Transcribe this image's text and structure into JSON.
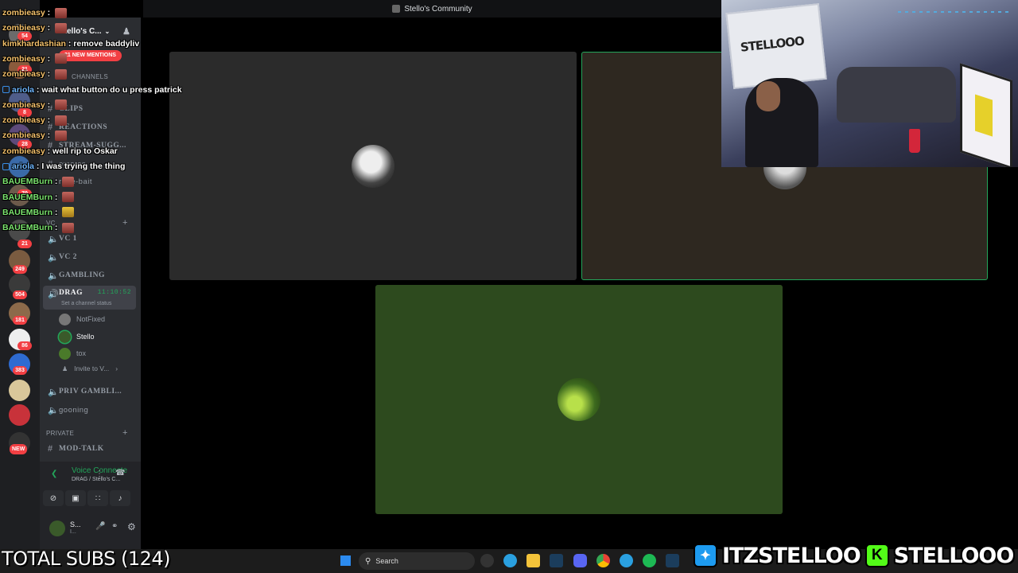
{
  "titlebar": {
    "title": "Stello's Community"
  },
  "server": {
    "name": "Stello's C...",
    "mentions_pill": "21 NEW MENTIONS"
  },
  "server_rail": {
    "badges": [
      "54",
      "21",
      "8",
      "28",
      "70",
      "21",
      "249",
      "504",
      "181",
      "86",
      "383"
    ],
    "new_badge": "NEW"
  },
  "channels": {
    "category_channels": "channels",
    "list": [
      {
        "name": "CLIPS"
      },
      {
        "name": "REACTIONS"
      },
      {
        "name": "STREAM-SUGG..."
      },
      {
        "name": "emotes"
      },
      {
        "name": "rage-bait"
      }
    ],
    "voice_category": "VC",
    "voice": [
      {
        "name": "VC 1"
      },
      {
        "name": "VC 2"
      },
      {
        "name": "GAMBLING"
      }
    ],
    "active_voice": {
      "name": "DRAG",
      "time": "11:10:52",
      "status": "Set a channel status"
    },
    "members": [
      {
        "name": "NotFixed"
      },
      {
        "name": "Stello"
      },
      {
        "name": "tox"
      }
    ],
    "invite": "Invite to V...",
    "after": [
      {
        "name": "PRIV GAMBLI..."
      },
      {
        "name": "gooning"
      }
    ],
    "private_category": "PRIVATE",
    "private": [
      {
        "name": "MOD-TALK"
      }
    ]
  },
  "voice_panel": {
    "status": "Voice Connecte",
    "sub": "DRAG / Stello's C...",
    "user": "S...",
    "user_sub": "I..."
  },
  "chat": [
    {
      "user": "zombieasy",
      "text": "",
      "color": "#f4c16b",
      "emote": "red"
    },
    {
      "user": "zombieasy",
      "text": "",
      "color": "#f4c16b",
      "emote": "red"
    },
    {
      "user": "kimkhardashian",
      "text": "remove baddyliv",
      "color": "#f4c16b",
      "emote": ""
    },
    {
      "user": "zombieasy",
      "text": "",
      "color": "#f4c16b",
      "emote": "red"
    },
    {
      "user": "zombieasy",
      "text": "",
      "color": "#f4c16b",
      "emote": "red"
    },
    {
      "user": "ariola",
      "text": "wait what button do u press patrick",
      "color": "#6fb7ff",
      "emote": ""
    },
    {
      "user": "zombieasy",
      "text": "",
      "color": "#f4c16b",
      "emote": "red"
    },
    {
      "user": "zombieasy",
      "text": "",
      "color": "#f4c16b",
      "emote": "red"
    },
    {
      "user": "zombieasy",
      "text": "",
      "color": "#f4c16b",
      "emote": "red"
    },
    {
      "user": "zombieasy",
      "text": "well rip to Oskar",
      "color": "#f4c16b",
      "emote": ""
    },
    {
      "user": "ariola",
      "text": "I was trying the thing",
      "color": "#6fb7ff",
      "emote": ""
    },
    {
      "user": "BAUEMBurn",
      "text": "",
      "color": "#7be36e",
      "emote": "red"
    },
    {
      "user": "BAUEMBurn",
      "text": "",
      "color": "#7be36e",
      "emote": "red"
    },
    {
      "user": "BAUEMBurn",
      "text": "",
      "color": "#7be36e",
      "emote": "gold"
    },
    {
      "user": "BAUEMBurn",
      "text": "",
      "color": "#7be36e",
      "emote": "red"
    }
  ],
  "webcam": {
    "board_text": "STELLOOO"
  },
  "taskbar": {
    "search_label": "Search"
  },
  "overlay": {
    "subs": "TOTAL SUBS (124)",
    "twitter_handle": "ITZSTELLOO",
    "kick_handle": "STELLOOO",
    "kick_letter": "K"
  },
  "colors": {
    "discord_green": "#23a55a",
    "twitter_blue": "#1d9bf0",
    "kick_green": "#53fc18",
    "mention_red": "#f23f43"
  }
}
